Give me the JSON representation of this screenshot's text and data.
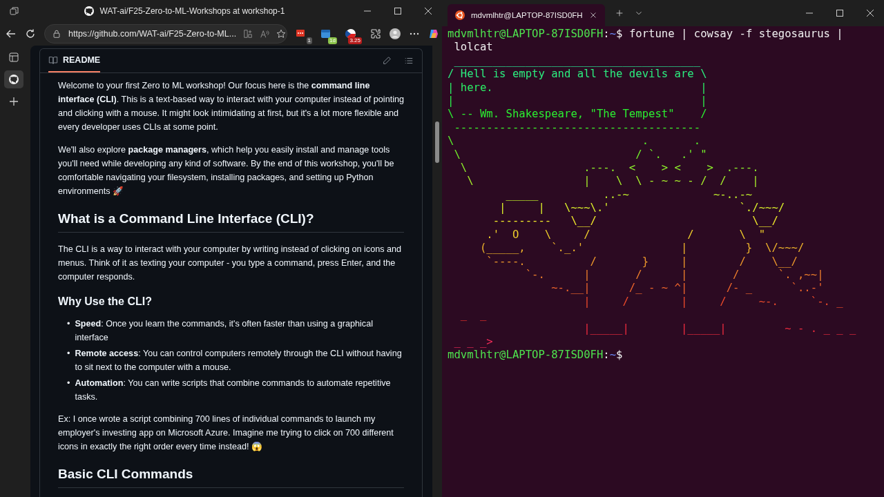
{
  "browser": {
    "window_title": "WAT-ai/F25-Zero-to-ML-Workshops at workshop-1",
    "url": "https://github.com/WAT-ai/F25-Zero-to-ML...",
    "extension_badges": [
      "1",
      "1d",
      "3.25"
    ],
    "sidebar": [
      {
        "kind": "tabs",
        "selected": false
      },
      {
        "kind": "github",
        "selected": true
      },
      {
        "kind": "add",
        "selected": false
      }
    ],
    "readme": {
      "tab_label": "README",
      "blocks": [
        {
          "kind": "p",
          "text": "Welcome to your first Zero to ML workshop! Our focus here is the **command line interface (CLI)**. This is a text-based way to interact with your computer instead of pointing and clicking with a mouse. It might look intimidating at first, but it's a lot more flexible and every developer uses CLIs at some point."
        },
        {
          "kind": "p",
          "text": "We'll also explore **package managers**, which help you easily install and manage tools you'll need while developing any kind of software. By the end of this workshop, you'll be comfortable navigating your filesystem, installing packages, and setting up Python environments 🚀"
        },
        {
          "kind": "h2",
          "text": "What is a Command Line Interface (CLI)?"
        },
        {
          "kind": "p",
          "text": "The CLI is a way to interact with your computer by writing instead of clicking on icons and menus. Think of it as texting your computer - you type a command, press Enter, and the computer responds."
        },
        {
          "kind": "h3",
          "text": "Why Use the CLI?"
        },
        {
          "kind": "ul",
          "items": [
            {
              "bullet": "•",
              "text": "**Speed**: Once you learn the commands, it's often faster than using a graphical interface"
            },
            {
              "bullet": "•",
              "text": "**Remote access**: You can control computers remotely through the CLI without having to sit next to the computer with a mouse."
            },
            {
              "bullet": "•",
              "text": "**Automation**: You can write scripts that combine commands to automate repetitive tasks."
            }
          ]
        },
        {
          "kind": "p",
          "text": "Ex: I once wrote a script combining 700 lines of individual commands to launch my employer's investing app on Microsoft Azure. Imagine me trying to click on 700 different icons in exactly the right order every time instead! 😱"
        },
        {
          "kind": "h2",
          "text": "Basic CLI Commands"
        }
      ]
    }
  },
  "terminal": {
    "tab_title": "mdvmlhtr@LAPTOP-87ISD0FH",
    "rows": [
      {
        "kind": "prompt",
        "user": "mdvmlhtr@LAPTOP-87ISD0FH",
        "colon": ":",
        "path": "~",
        "dollar": "$",
        "command": " fortune | cowsay -f stegosaurus |"
      },
      {
        "kind": "plain",
        "text": " lolcat"
      },
      {
        "kind": "rainbow",
        "text": " ______________________________________"
      },
      {
        "kind": "rainbow",
        "text": "/ Hell is empty and all the devils are \\"
      },
      {
        "kind": "rainbow",
        "text": "| here.                                |"
      },
      {
        "kind": "rainbow",
        "text": "|                                      |"
      },
      {
        "kind": "rainbow",
        "text": "\\ -- Wm. Shakespeare, \"The Tempest\"    /"
      },
      {
        "kind": "rainbow",
        "text": " --------------------------------------"
      },
      {
        "kind": "rainbow",
        "text": "\\                             .       ."
      },
      {
        "kind": "rainbow",
        "text": " \\                           / `.   .' \""
      },
      {
        "kind": "rainbow",
        "text": "  \\                  .---.  <    > <    >  .---."
      },
      {
        "kind": "rainbow",
        "text": "   \\                 |    \\  \\ - ~ ~ - /  /    |"
      },
      {
        "kind": "rainbow",
        "text": "         _____          ..-~             ~-..-~"
      },
      {
        "kind": "rainbow",
        "text": "        |     |   \\~~~\\.'                    `./~~~/"
      },
      {
        "kind": "rainbow",
        "text": "       ---------   \\__/                        \\__/"
      },
      {
        "kind": "rainbow",
        "text": "      .'  O    \\     /               /       \\  \""
      },
      {
        "kind": "rainbow",
        "text": "     (_____,    `._.'               |         }  \\/~~~/"
      },
      {
        "kind": "rainbow",
        "text": "      `----.          /       }     |        /    \\__/"
      },
      {
        "kind": "rainbow",
        "text": "            `-.      |       /      |       /      `. ,~~|"
      },
      {
        "kind": "rainbow",
        "text": "                ~-.__|      /_ - ~ ^|      /- _      `..-'"
      },
      {
        "kind": "rainbow",
        "text": "                     |     /        |     /     ~-.     `-. _"
      },
      {
        "kind": "rainbow",
        "text": "  _  _"
      },
      {
        "kind": "rainbow",
        "text": "                     |_____|        |_____|         ~ - . _ _ _"
      },
      {
        "kind": "rainbow",
        "text": " _ _ _>"
      },
      {
        "kind": "prompt",
        "user": "mdvmlhtr@LAPTOP-87ISD0FH",
        "colon": ":",
        "path": "~",
        "dollar": "$",
        "command": ""
      }
    ]
  }
}
